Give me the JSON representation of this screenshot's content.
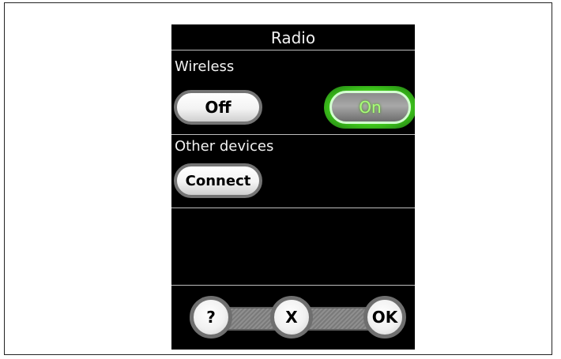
{
  "screen": {
    "title": "Radio"
  },
  "wireless": {
    "label": "Wireless",
    "off_label": "Off",
    "on_label": "On",
    "selected": "On"
  },
  "other_devices": {
    "label": "Other devices",
    "connect_label": "Connect"
  },
  "footer": {
    "help_label": "?",
    "close_label": "X",
    "ok_label": "OK"
  },
  "colors": {
    "background": "#000000",
    "active_glow": "#3ec51b",
    "active_text": "#a8ff77",
    "button_face": "#f3f3f3"
  }
}
